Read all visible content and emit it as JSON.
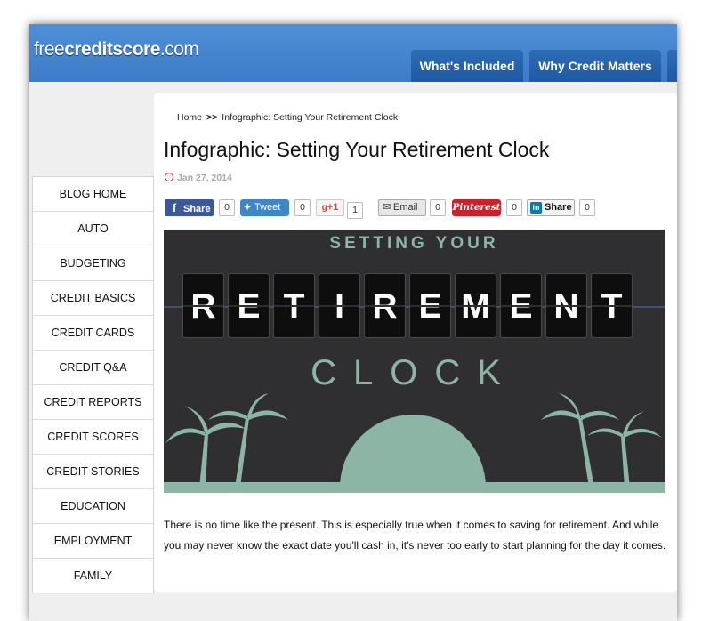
{
  "header": {
    "logo_pre": "free",
    "logo_bold": "creditscore",
    "logo_post": ".com",
    "nav": [
      "What's Included",
      "Why Credit Matters"
    ]
  },
  "sidebar": {
    "items": [
      "BLOG HOME",
      "AUTO",
      "BUDGETING",
      "CREDIT BASICS",
      "CREDIT CARDS",
      "CREDIT Q&A",
      "CREDIT REPORTS",
      "CREDIT SCORES",
      "CREDIT STORIES",
      "EDUCATION",
      "EMPLOYMENT",
      "FAMILY"
    ]
  },
  "article": {
    "breadcrumb_home": "Home",
    "breadcrumb_sep": ">>",
    "breadcrumb_current": "Infographic: Setting Your Retirement Clock",
    "title": "Infographic: Setting Your Retirement Clock",
    "date": "Jan 27, 2014",
    "share": {
      "facebook_label": "Share",
      "facebook_count": "0",
      "twitter_label": "Tweet",
      "twitter_count": "0",
      "gplus_label": "+1",
      "gplus_count": "1",
      "email_label": "Email",
      "email_count": "0",
      "pinterest_label": "Pinterest",
      "pinterest_count": "0",
      "linkedin_label": "Share",
      "linkedin_count": "0"
    },
    "hero": {
      "subtitle": "SETTING YOUR",
      "letters": [
        "R",
        "E",
        "T",
        "I",
        "R",
        "E",
        "M",
        "E",
        "N",
        "T"
      ],
      "bottom": "CLOCK"
    },
    "body": "There is no time like the present. This is especially true when it comes to saving for retirement. And while you may never know the exact date you'll cash in, it's never too early to start planning for the day it comes."
  },
  "colors": {
    "header_blue": "#3c7cc8",
    "nav_tab": "#1f5aa3",
    "hero_bg": "#2f2e30",
    "hero_accent": "#8db5a6"
  }
}
